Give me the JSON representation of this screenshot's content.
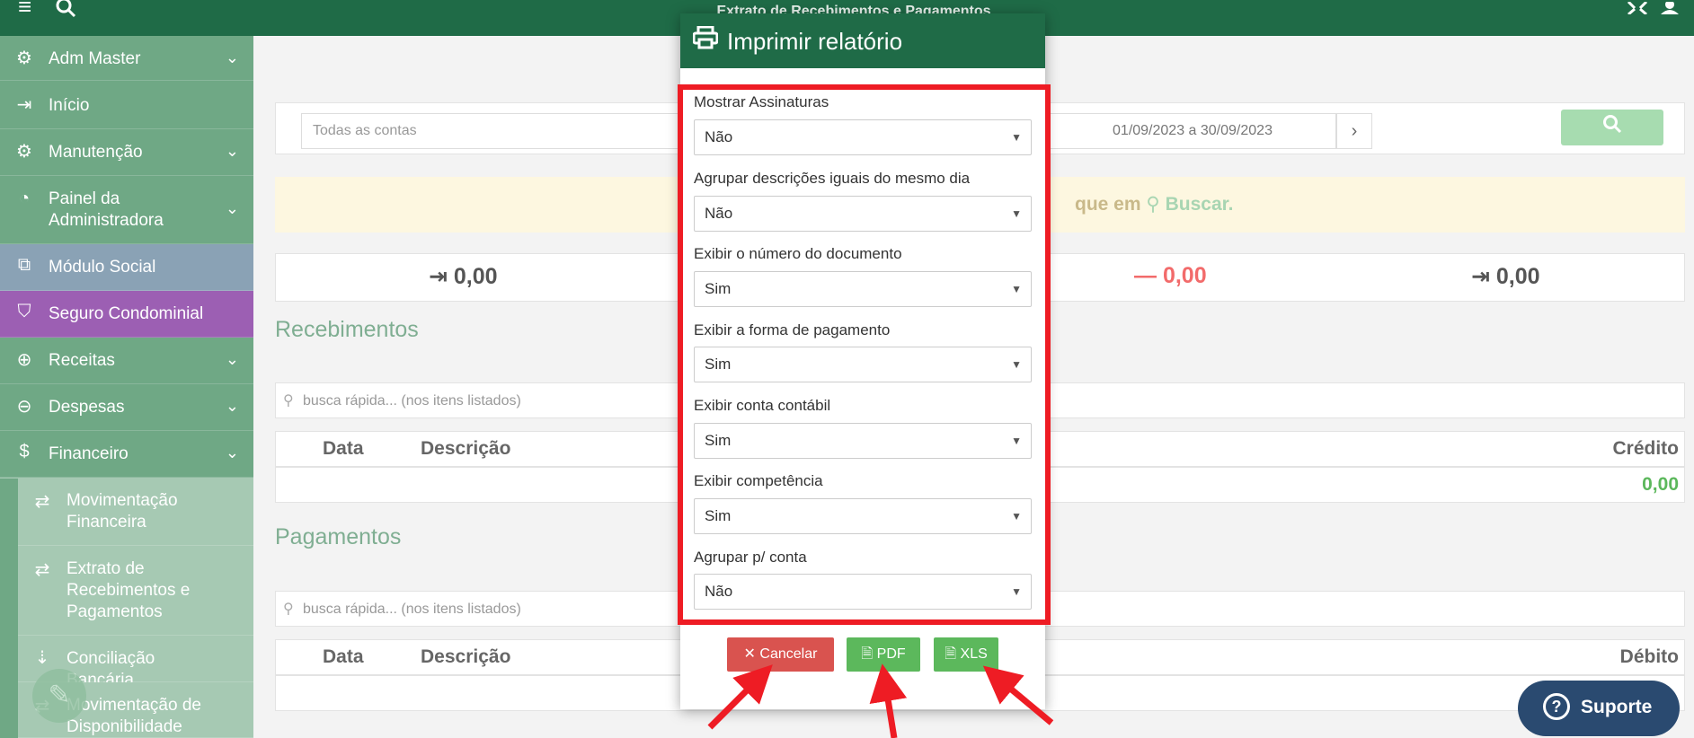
{
  "topbar": {
    "title": "Extrato de Recebimentos e Pagamentos",
    "menu_icon": "hamburger-icon",
    "search_icon": "search-icon",
    "expand_icon": "expand-icon",
    "user_icon": "user-icon"
  },
  "sidebar": {
    "items": [
      {
        "label": "Adm Master",
        "icon": "gears-icon"
      },
      {
        "label": "Início",
        "icon": "sign-in-icon"
      },
      {
        "label": "Manutenção",
        "icon": "gear-icon"
      },
      {
        "label": "Painel da Administradora",
        "icon": "pie-chart-icon"
      },
      {
        "label": "Módulo Social",
        "icon": "external-link-icon"
      },
      {
        "label": "Seguro Condominial",
        "icon": "shield-icon"
      },
      {
        "label": "Receitas",
        "icon": "arrow-up-circle-icon"
      },
      {
        "label": "Despesas",
        "icon": "arrow-down-circle-icon"
      },
      {
        "label": "Financeiro",
        "icon": "dollar-icon"
      }
    ],
    "sub_items": [
      {
        "label": "Movimentação Financeira",
        "icon": "exchange-icon"
      },
      {
        "label": "Extrato de Recebimentos e Pagamentos",
        "icon": "exchange-icon"
      },
      {
        "label": "Conciliação Bancária",
        "icon": "sort-icon"
      },
      {
        "label": "Movimentação de Disponibilidade",
        "icon": "exchange-icon"
      }
    ]
  },
  "filters": {
    "account_placeholder": "Todas as contas",
    "date_range": "01/09/2023 a 30/09/2023",
    "next_icon": "chevron-right-icon"
  },
  "notice": {
    "text": "que em",
    "link": "Buscar."
  },
  "totals": {
    "entrada": "0,00",
    "saida": "0,00",
    "saldo": "0,00"
  },
  "recebimentos": {
    "title": "Recebimentos",
    "search_placeholder": "busca rápida... (nos itens listados)",
    "col_data": "Data",
    "col_descricao": "Descrição",
    "col_credito": "Crédito",
    "total": "0,00"
  },
  "pagamentos": {
    "title": "Pagamentos",
    "search_placeholder": "busca rápida... (nos itens listados)",
    "col_data": "Data",
    "col_descricao": "Descrição",
    "col_debito": "Débito"
  },
  "modal": {
    "title": "Imprimir relatório",
    "fields": [
      {
        "label": "Mostrar Assinaturas",
        "value": "Não"
      },
      {
        "label": "Agrupar descrições iguais do mesmo dia",
        "value": "Não"
      },
      {
        "label": "Exibir o número do documento",
        "value": "Sim"
      },
      {
        "label": "Exibir a forma de pagamento",
        "value": "Sim"
      },
      {
        "label": "Exibir conta contábil",
        "value": "Sim"
      },
      {
        "label": "Exibir competência",
        "value": "Sim"
      },
      {
        "label": "Agrupar p/ conta",
        "value": "Não"
      }
    ],
    "cancel_label": "Cancelar",
    "pdf_label": "PDF",
    "xls_label": "XLS"
  },
  "support": {
    "label": "Suporte"
  },
  "colors": {
    "brand_green": "#1f6b47",
    "sidebar_green": "#6fa885",
    "highlight_red": "#ee1c24",
    "cancel_red": "#d9534f",
    "ok_green": "#5cb85c"
  }
}
